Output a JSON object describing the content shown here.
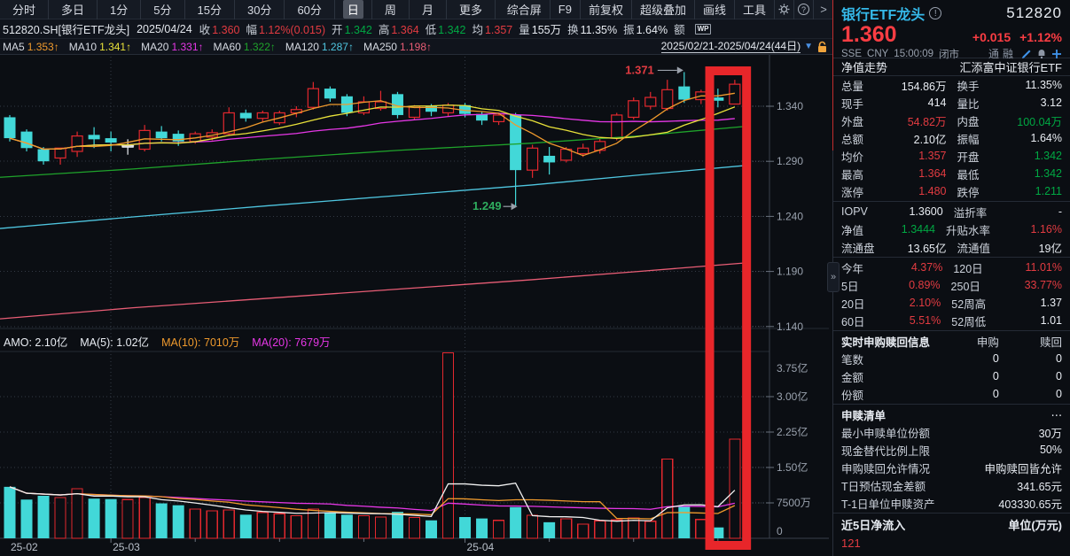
{
  "colors": {
    "up_red": "#e3282e",
    "down_cyan": "#42d8d8",
    "value_red": "#e23b41",
    "value_green": "#00a843",
    "value_white": "#e8ecf2",
    "ma5": "#ef9a2d",
    "ma10": "#e8e13a",
    "ma20": "#e637e6",
    "ma60": "#1fa32b",
    "ma120": "#4fc6e0",
    "ma250": "#e85d75",
    "vol_ma5": "#f0f0f0",
    "vol_ma10": "#ef9a2d",
    "vol_ma20": "#e637e6",
    "highlight_box": "#e8262a",
    "annotation_high": "#e23b41",
    "annotation_low": "#2fae5f",
    "axis_text": "#9aa2ae",
    "grid": "#333a45"
  },
  "toolbar": {
    "period_tabs": [
      "分时",
      "多日",
      "1分",
      "5分",
      "15分",
      "30分",
      "60分",
      "日",
      "周",
      "月",
      "更多"
    ],
    "selected_tab": "日",
    "tools_menu": [
      "综合屏",
      "F9",
      "前复权",
      "超级叠加",
      "画线",
      "工具"
    ],
    "help_label": "?",
    "chevron_label": ">"
  },
  "quote_bar": {
    "symbol": "512820.SH[银行ETF龙头]",
    "date": "2025/04/24",
    "wp_badge": "WP",
    "fields": [
      {
        "l": "收",
        "v": "1.360",
        "c": "r"
      },
      {
        "l": "幅",
        "v": "1.12%(0.015)",
        "c": "r"
      },
      {
        "l": "开",
        "v": "1.342",
        "c": "g"
      },
      {
        "l": "高",
        "v": "1.364",
        "c": "r"
      },
      {
        "l": "低",
        "v": "1.342",
        "c": "g"
      },
      {
        "l": "均",
        "v": "1.357",
        "c": "r"
      },
      {
        "l": "量",
        "v": "155万",
        "c": "w"
      },
      {
        "l": "换",
        "v": "11.35%",
        "c": "w"
      },
      {
        "l": "振",
        "v": "1.64%",
        "c": "w"
      },
      {
        "l": "额",
        "v": "",
        "c": "w"
      }
    ]
  },
  "ma_bar": {
    "items": [
      {
        "label": "MA5",
        "value": "1.353",
        "arrow": "↑",
        "color_key": "ma5"
      },
      {
        "label": "MA10",
        "value": "1.341",
        "arrow": "↑",
        "color_key": "ma10"
      },
      {
        "label": "MA20",
        "value": "1.331",
        "arrow": "↑",
        "color_key": "ma20"
      },
      {
        "label": "MA60",
        "value": "1.322",
        "arrow": "↑",
        "color_key": "ma60"
      },
      {
        "label": "MA120",
        "value": "1.287",
        "arrow": "↑",
        "color_key": "ma120"
      },
      {
        "label": "MA250",
        "value": "1.198",
        "arrow": "↑",
        "color_key": "ma250"
      }
    ],
    "date_range": "2025/02/21-2025/04/24(44日)",
    "dropdown_icon": "▼"
  },
  "chart_data": {
    "type": "candlestick",
    "title": "512820.SH 银行ETF龙头 日K",
    "date_range": "2025/02/21-2025/04/24(44日)",
    "price_axis_values": [
      1.34,
      1.29,
      1.24,
      1.19,
      1.14
    ],
    "price_axis_ticks": [
      "1.340",
      "1.290",
      "1.240",
      "1.190",
      "1.140"
    ],
    "volume_axis_ticks": [
      {
        "label": "3.75亿",
        "v": 3.75
      },
      {
        "label": "3.00亿",
        "v": 3.0
      },
      {
        "label": "2.25亿",
        "v": 2.25
      },
      {
        "label": "1.50亿",
        "v": 1.5
      },
      {
        "label": "7500万",
        "v": 0.75
      },
      {
        "label": "0",
        "v": 0
      }
    ],
    "x_labels": [
      {
        "label": "25-02",
        "index": 0
      },
      {
        "label": "25-03",
        "index": 6
      },
      {
        "label": "25-04",
        "index": 27
      }
    ],
    "month_grid_indices": [
      6,
      27
    ],
    "tick_indices": [
      11,
      16,
      21,
      32,
      37,
      42
    ],
    "candles": [
      [
        1.33,
        1.332,
        1.308,
        1.311
      ],
      [
        1.317,
        1.319,
        1.299,
        1.302
      ],
      [
        1.301,
        1.303,
        1.287,
        1.29
      ],
      [
        1.293,
        1.297,
        1.287,
        1.302
      ],
      [
        1.299,
        1.317,
        1.294,
        1.313
      ],
      [
        1.314,
        1.321,
        1.302,
        1.31
      ],
      [
        1.311,
        1.317,
        1.299,
        1.307
      ],
      [
        1.304,
        1.31,
        1.296,
        1.304
      ],
      [
        1.301,
        1.323,
        1.299,
        1.318
      ],
      [
        1.317,
        1.322,
        1.308,
        1.311
      ],
      [
        1.315,
        1.318,
        1.304,
        1.308
      ],
      [
        1.308,
        1.317,
        1.306,
        1.315
      ],
      [
        1.312,
        1.319,
        1.309,
        1.316
      ],
      [
        1.315,
        1.339,
        1.313,
        1.334
      ],
      [
        1.334,
        1.337,
        1.326,
        1.329
      ],
      [
        1.329,
        1.336,
        1.326,
        1.334
      ],
      [
        1.325,
        1.336,
        1.323,
        1.334
      ],
      [
        1.334,
        1.34,
        1.33,
        1.337
      ],
      [
        1.339,
        1.362,
        1.337,
        1.356
      ],
      [
        1.356,
        1.358,
        1.344,
        1.347
      ],
      [
        1.349,
        1.351,
        1.331,
        1.334
      ],
      [
        1.334,
        1.349,
        1.332,
        1.344
      ],
      [
        1.338,
        1.354,
        1.336,
        1.344
      ],
      [
        1.351,
        1.353,
        1.329,
        1.332
      ],
      [
        1.33,
        1.341,
        1.328,
        1.34
      ],
      [
        1.34,
        1.342,
        1.331,
        1.335
      ],
      [
        1.334,
        1.343,
        1.331,
        1.341
      ],
      [
        1.341,
        1.343,
        1.33,
        1.333
      ],
      [
        1.333,
        1.335,
        1.323,
        1.327
      ],
      [
        1.326,
        1.334,
        1.323,
        1.332
      ],
      [
        1.332,
        1.334,
        1.249,
        1.282
      ],
      [
        1.282,
        1.305,
        1.275,
        1.302
      ],
      [
        1.295,
        1.303,
        1.278,
        1.289
      ],
      [
        1.291,
        1.303,
        1.289,
        1.301
      ],
      [
        1.297,
        1.306,
        1.294,
        1.302
      ],
      [
        1.3,
        1.311,
        1.297,
        1.308
      ],
      [
        1.311,
        1.334,
        1.309,
        1.332
      ],
      [
        1.33,
        1.348,
        1.328,
        1.345
      ],
      [
        1.34,
        1.353,
        1.337,
        1.348
      ],
      [
        1.338,
        1.364,
        1.336,
        1.355
      ],
      [
        1.358,
        1.371,
        1.343,
        1.346
      ],
      [
        1.346,
        1.355,
        1.342,
        1.353
      ],
      [
        1.348,
        1.356,
        1.339,
        1.345
      ],
      [
        1.342,
        1.364,
        1.342,
        1.36
      ]
    ],
    "volumes_yi": [
      1.09,
      0.82,
      0.9,
      0.86,
      1.05,
      0.84,
      0.83,
      0.82,
      0.86,
      0.74,
      0.7,
      0.62,
      0.58,
      0.6,
      0.5,
      0.55,
      0.52,
      0.48,
      0.62,
      0.55,
      0.5,
      0.48,
      0.45,
      0.56,
      0.44,
      0.38,
      3.93,
      0.45,
      0.42,
      0.38,
      0.66,
      0.49,
      0.34,
      0.41,
      0.3,
      0.37,
      0.39,
      0.43,
      0.36,
      1.68,
      0.68,
      0.4,
      0.23,
      2.1
    ],
    "white_cross_index": 7,
    "long_ma": {
      "ma60": [
        [
          0,
          1.2755
        ],
        [
          150,
          1.283
        ],
        [
          300,
          1.292
        ],
        [
          450,
          1.3
        ],
        [
          600,
          1.3065
        ],
        [
          720,
          1.313
        ],
        [
          845,
          1.322
        ]
      ],
      "ma120": [
        [
          0,
          1.229
        ],
        [
          150,
          1.2395
        ],
        [
          300,
          1.2495
        ],
        [
          450,
          1.259
        ],
        [
          600,
          1.2685
        ],
        [
          720,
          1.2775
        ],
        [
          845,
          1.2865
        ]
      ],
      "ma250": [
        [
          0,
          1.147
        ],
        [
          150,
          1.157
        ],
        [
          300,
          1.1655
        ],
        [
          450,
          1.174
        ],
        [
          600,
          1.1825
        ],
        [
          720,
          1.19
        ],
        [
          845,
          1.198
        ]
      ]
    },
    "amo_row": {
      "amo": "AMO: 2.10亿",
      "ma5": "MA(5): 1.02亿",
      "ma10": "MA(10): 7010万",
      "ma20": "MA(20): 7679万"
    },
    "annotations": {
      "high": {
        "text": "1.371",
        "index": 40,
        "price": 1.371
      },
      "low": {
        "text": "1.249",
        "index": 30,
        "price": 1.249
      }
    },
    "highlight_box": {
      "from_index": 42,
      "to_index": 43
    }
  },
  "side_panel": {
    "title": "银行ETF龙头",
    "info_icon": "!",
    "code": "512820",
    "price": "1.360",
    "change": "+0.015",
    "change_pct": "+1.12%",
    "exchange": "SSE",
    "currency": "CNY",
    "time": "15:00:09",
    "session": "闭市",
    "badges": [
      "通",
      "融"
    ],
    "collapse_icon": "»",
    "nav_row": {
      "left": "净值走势",
      "right": "汇添富中证银行ETF"
    },
    "quote_rows": [
      [
        {
          "l": "总量",
          "v": "154.86万",
          "c": "w"
        },
        {
          "l": "换手",
          "v": "11.35%",
          "c": "w"
        }
      ],
      [
        {
          "l": "现手",
          "v": "414",
          "c": "w"
        },
        {
          "l": "量比",
          "v": "3.12",
          "c": "w"
        }
      ],
      [
        {
          "l": "外盘",
          "v": "54.82万",
          "c": "r"
        },
        {
          "l": "内盘",
          "v": "100.04万",
          "c": "g"
        }
      ],
      [
        {
          "l": "总额",
          "v": "2.10亿",
          "c": "w"
        },
        {
          "l": "振幅",
          "v": "1.64%",
          "c": "w"
        }
      ],
      [
        {
          "l": "均价",
          "v": "1.357",
          "c": "r"
        },
        {
          "l": "开盘",
          "v": "1.342",
          "c": "g"
        }
      ],
      [
        {
          "l": "最高",
          "v": "1.364",
          "c": "r"
        },
        {
          "l": "最低",
          "v": "1.342",
          "c": "g"
        }
      ],
      [
        {
          "l": "涨停",
          "v": "1.480",
          "c": "r"
        },
        {
          "l": "跌停",
          "v": "1.211",
          "c": "g"
        }
      ]
    ],
    "iopv_rows": [
      [
        {
          "l": "IOPV",
          "v": "1.3600",
          "c": "w"
        },
        {
          "l": "溢折率",
          "v": "-",
          "c": "w"
        }
      ],
      [
        {
          "l": "净值",
          "v": "1.3444",
          "c": "g"
        },
        {
          "l": "升贴水率",
          "v": "1.16%",
          "c": "r"
        }
      ],
      [
        {
          "l": "流通盘",
          "v": "13.65亿",
          "c": "w"
        },
        {
          "l": "流通值",
          "v": "19亿",
          "c": "w"
        }
      ]
    ],
    "perf_rows": [
      [
        {
          "l": "今年",
          "v": "4.37%",
          "c": "r"
        },
        {
          "l": "120日",
          "v": "11.01%",
          "c": "r"
        }
      ],
      [
        {
          "l": "5日",
          "v": "0.89%",
          "c": "r"
        },
        {
          "l": "250日",
          "v": "33.77%",
          "c": "r"
        }
      ],
      [
        {
          "l": "20日",
          "v": "2.10%",
          "c": "r"
        },
        {
          "l": "52周高",
          "v": "1.37",
          "c": "w"
        }
      ],
      [
        {
          "l": "60日",
          "v": "5.51%",
          "c": "r"
        },
        {
          "l": "52周低",
          "v": "1.01",
          "c": "w"
        }
      ]
    ],
    "subscription": {
      "header": [
        "实时申购赎回信息",
        "申购",
        "赎回"
      ],
      "rows": [
        [
          "笔数",
          "0",
          "0"
        ],
        [
          "金额",
          "0",
          "0"
        ],
        [
          "份额",
          "0",
          "0"
        ]
      ]
    },
    "redemption": {
      "header": "申赎清单",
      "more": "⋯",
      "rows": [
        [
          "最小申赎单位份额",
          "30万"
        ],
        [
          "现金替代比例上限",
          "50%"
        ],
        [
          "申购赎回允许情况",
          "申购赎回皆允许"
        ],
        [
          "T日预估现金差额",
          "341.65元"
        ],
        [
          "T-1日单位申赎资产",
          "403330.65元"
        ]
      ]
    },
    "netflow": {
      "header": "近5日净流入",
      "unit": "单位(万元)",
      "partial_value": "121"
    }
  }
}
